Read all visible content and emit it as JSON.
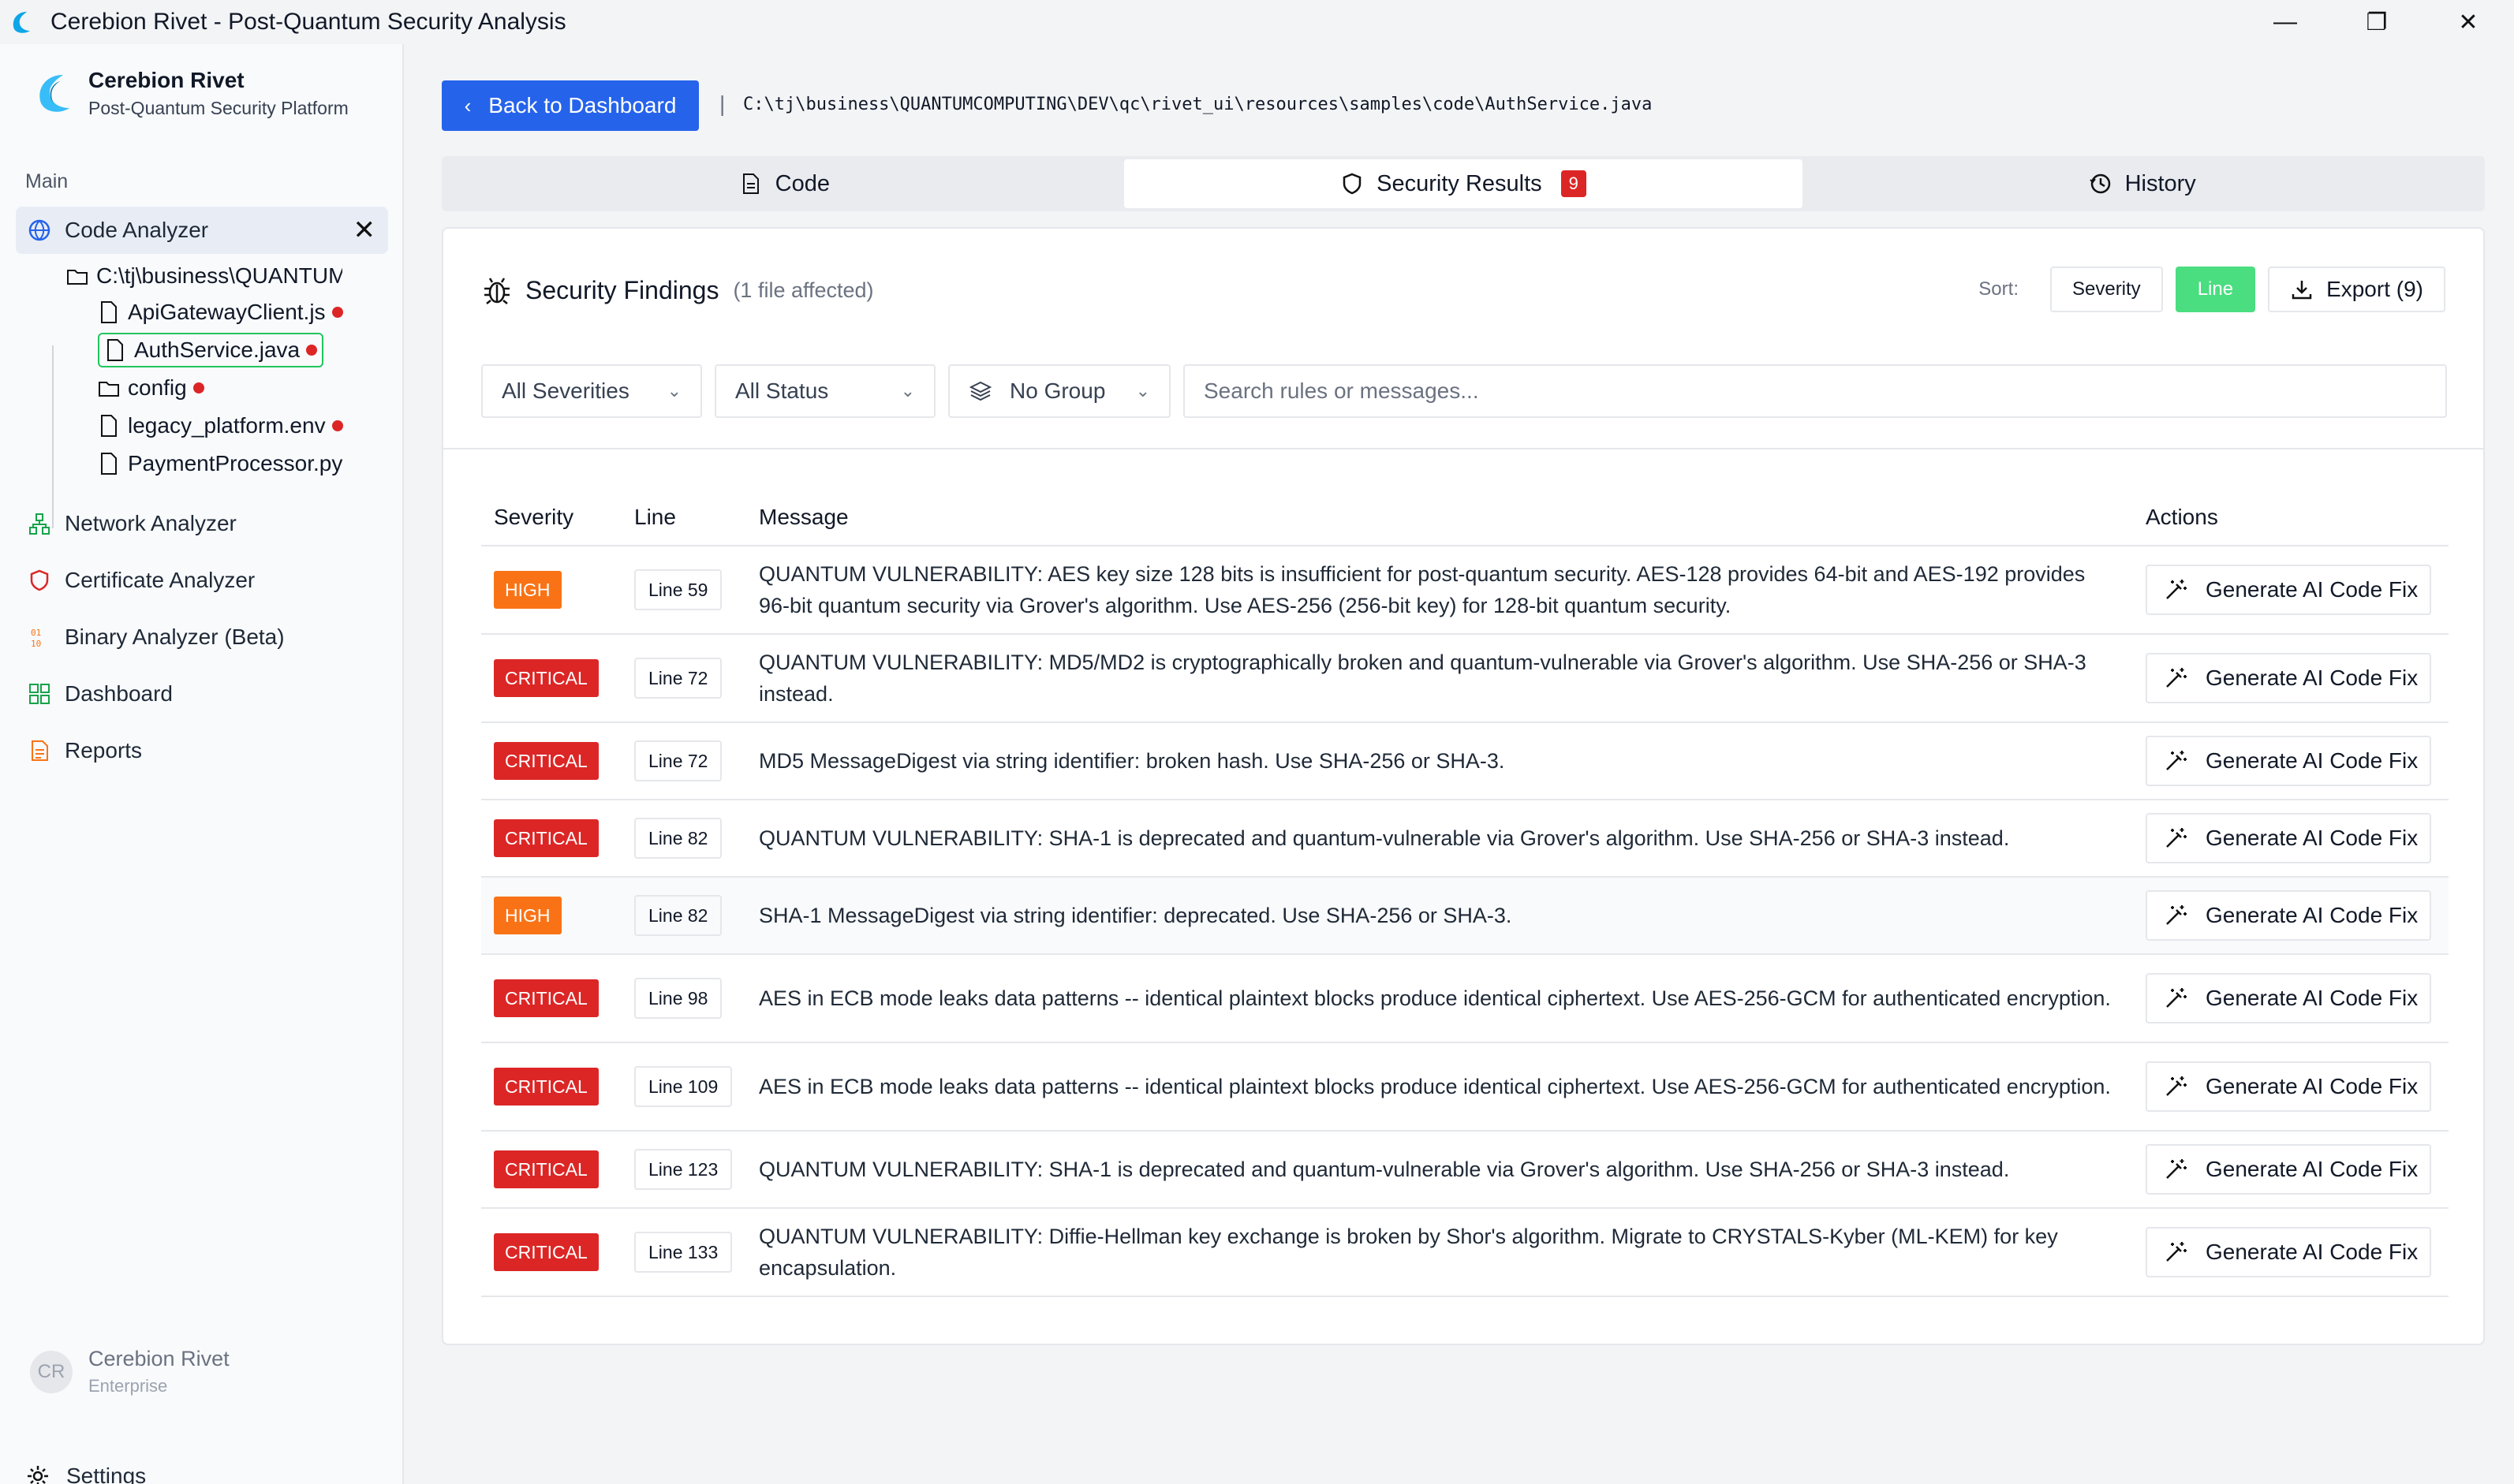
{
  "window": {
    "title": "Cerebion Rivet - Post-Quantum Security Analysis",
    "controls": [
      "—",
      "❐",
      "✕"
    ]
  },
  "sidebar": {
    "brand_name": "Cerebion Rivet",
    "brand_sub": "Post-Quantum Security Platform",
    "section_label": "Main",
    "active_item": "Code Analyzer",
    "tree": {
      "folder": "C:\\tj\\business\\QUANTUM",
      "files": [
        {
          "name": "ApiGatewayClient.js",
          "issues": true
        },
        {
          "name": "AuthService.java",
          "issues": true,
          "selected": true
        },
        {
          "name": "config",
          "issues": true,
          "folder": true
        },
        {
          "name": "legacy_platform.env",
          "issues": true
        },
        {
          "name": "PaymentProcessor.py",
          "issues": false
        }
      ]
    },
    "items": [
      {
        "label": "Network Analyzer",
        "icon": "network-icon"
      },
      {
        "label": "Certificate Analyzer",
        "icon": "shield-icon"
      },
      {
        "label": "Binary Analyzer (Beta)",
        "icon": "binary-icon"
      },
      {
        "label": "Dashboard",
        "icon": "grid-icon"
      },
      {
        "label": "Reports",
        "icon": "report-icon"
      }
    ],
    "user": {
      "initials": "CR",
      "name": "Cerebion Rivet",
      "tier": "Enterprise"
    },
    "settings_label": "Settings"
  },
  "toolbar": {
    "back_label": "Back to Dashboard",
    "separator": "|",
    "file_path": "C:\\tj\\business\\QUANTUMCOMPUTING\\DEV\\qc\\rivet_ui\\resources\\samples\\code\\AuthService.java"
  },
  "tabs": [
    {
      "label": "Code",
      "active": false
    },
    {
      "label": "Security Results",
      "active": true,
      "count": "9"
    },
    {
      "label": "History",
      "active": false
    }
  ],
  "findings": {
    "title": "Security Findings",
    "subtitle": "(1 file affected)",
    "sort_label": "Sort:",
    "sort_options": [
      "Severity",
      "Line"
    ],
    "sort_active": "Line",
    "export_label": "Export (9)",
    "filters": {
      "severity": "All Severities",
      "status": "All Status",
      "group": "No Group",
      "search_placeholder": "Search rules or messages..."
    },
    "columns": [
      "Severity",
      "Line",
      "Message",
      "Actions"
    ],
    "action_label": "Generate AI Code Fix",
    "rows": [
      {
        "severity": "HIGH",
        "line": "Line 59",
        "message": "QUANTUM VULNERABILITY: AES key size 128 bits is insufficient for post-quantum security. AES-128 provides 64-bit and AES-192 provides 96-bit quantum security via Grover's algorithm. Use AES-256 (256-bit key) for 128-bit quantum security."
      },
      {
        "severity": "CRITICAL",
        "line": "Line 72",
        "message": "QUANTUM VULNERABILITY: MD5/MD2 is cryptographically broken and quantum-vulnerable via Grover's algorithm. Use SHA-256 or SHA-3 instead."
      },
      {
        "severity": "CRITICAL",
        "line": "Line 72",
        "message": "MD5 MessageDigest via string identifier: broken hash. Use SHA-256 or SHA-3."
      },
      {
        "severity": "CRITICAL",
        "line": "Line 82",
        "message": "QUANTUM VULNERABILITY: SHA-1 is deprecated and quantum-vulnerable via Grover's algorithm. Use SHA-256 or SHA-3 instead."
      },
      {
        "severity": "HIGH",
        "line": "Line 82",
        "message": "SHA-1 MessageDigest via string identifier: deprecated. Use SHA-256 or SHA-3.",
        "highlight": true
      },
      {
        "severity": "CRITICAL",
        "line": "Line 98",
        "message": "AES in ECB mode leaks data patterns -- identical plaintext blocks produce identical ciphertext. Use AES-256-GCM for authenticated encryption."
      },
      {
        "severity": "CRITICAL",
        "line": "Line 109",
        "message": "AES in ECB mode leaks data patterns -- identical plaintext blocks produce identical ciphertext. Use AES-256-GCM for authenticated encryption."
      },
      {
        "severity": "CRITICAL",
        "line": "Line 123",
        "message": "QUANTUM VULNERABILITY: SHA-1 is deprecated and quantum-vulnerable via Grover's algorithm. Use SHA-256 or SHA-3 instead."
      },
      {
        "severity": "CRITICAL",
        "line": "Line 133",
        "message": "QUANTUM VULNERABILITY: Diffie-Hellman key exchange is broken by Shor's algorithm. Migrate to CRYSTALS-Kyber (ML-KEM) for key encapsulation."
      }
    ]
  },
  "colors": {
    "accent": "#2563eb",
    "high": "#f97316",
    "critical": "#dc2626",
    "sort_active": "#4ade80"
  }
}
